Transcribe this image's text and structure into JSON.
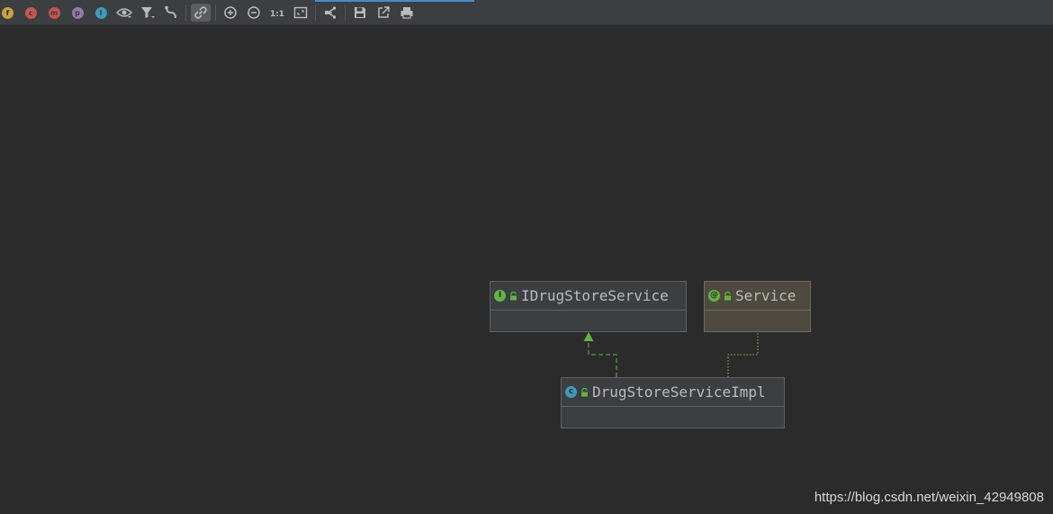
{
  "toolbar": {
    "buttons": [
      {
        "name": "show-fields-button",
        "icon": "field-icon",
        "glyph": "f",
        "color": "#c9a141"
      },
      {
        "name": "show-constructors-button",
        "icon": "constructor-icon",
        "glyph": "c",
        "color": "#c75450"
      },
      {
        "name": "show-methods-button",
        "icon": "method-icon",
        "glyph": "m",
        "color": "#c75450"
      },
      {
        "name": "show-properties-button",
        "icon": "property-icon",
        "glyph": "p",
        "color": "#9876aa"
      },
      {
        "name": "show-inner-classes-button",
        "icon": "inner-class-icon",
        "glyph": "I",
        "color": "#3d9bb8"
      }
    ],
    "accent_color": "#4a88c7"
  },
  "diagram": {
    "nodes": {
      "interface": {
        "title": "IDrugStoreService",
        "kind_glyph": "I",
        "kind_color": "#62b543"
      },
      "annotation": {
        "title": "Service",
        "kind_glyph": "@",
        "kind_color": "#62b543"
      },
      "implementation": {
        "title": "DrugStoreServiceImpl",
        "kind_glyph": "c",
        "kind_color": "#3d9bb8"
      }
    },
    "edge_colors": {
      "implements": "#62b543",
      "annotated_by": "#a9b74d"
    }
  },
  "watermark": "https://blog.csdn.net/weixin_42949808"
}
